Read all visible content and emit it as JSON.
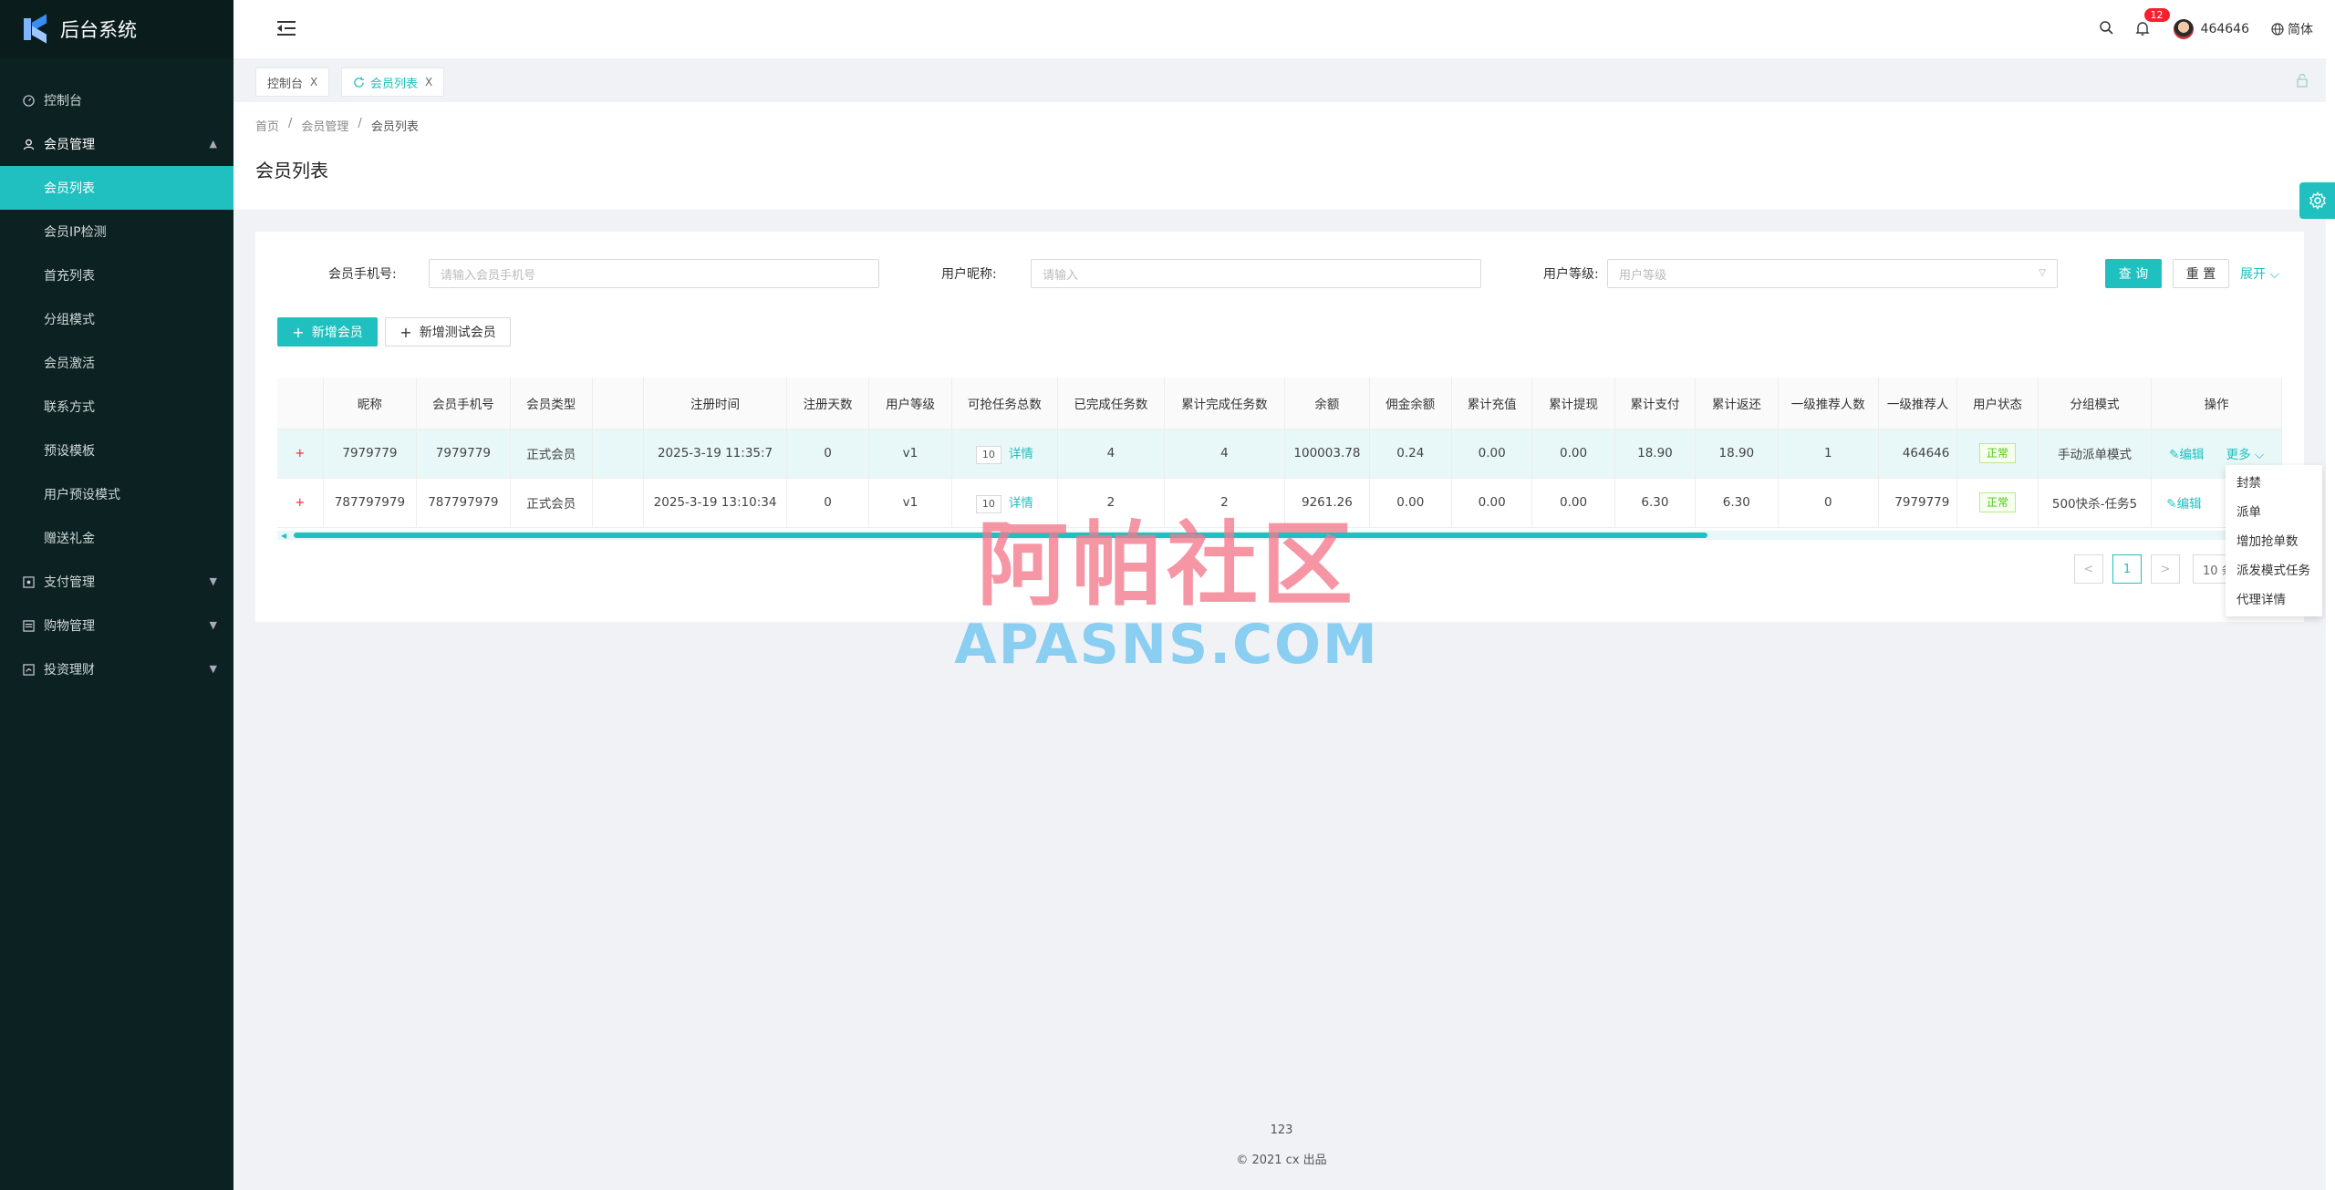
{
  "app": {
    "title": "后台系统"
  },
  "sidebar": {
    "items": [
      {
        "label": "控制台",
        "icon": "dashboard-icon"
      },
      {
        "label": "会员管理",
        "icon": "user-icon",
        "open": true,
        "children": [
          {
            "label": "会员列表",
            "active": true
          },
          {
            "label": "会员IP检测"
          },
          {
            "label": "首充列表"
          },
          {
            "label": "分组模式"
          },
          {
            "label": "会员激活"
          },
          {
            "label": "联系方式"
          },
          {
            "label": "预设模板"
          },
          {
            "label": "用户预设模式"
          },
          {
            "label": "赠送礼金"
          }
        ]
      },
      {
        "label": "支付管理",
        "icon": "pay-icon"
      },
      {
        "label": "购物管理",
        "icon": "shop-icon"
      },
      {
        "label": "投资理财",
        "icon": "invest-icon"
      }
    ]
  },
  "header": {
    "notifications": "12",
    "username": "464646",
    "language": "简体"
  },
  "tabs": [
    {
      "label": "控制台",
      "close": "X"
    },
    {
      "label": "会员列表",
      "close": "X",
      "active": true
    }
  ],
  "breadcrumb": [
    "首页",
    "/",
    "会员管理",
    "/",
    "会员列表"
  ],
  "page_title": "会员列表",
  "filters": {
    "phone_label": "会员手机号:",
    "phone_placeholder": "请输入会员手机号",
    "nick_label": "用户昵称:",
    "nick_placeholder": "请输入",
    "level_label": "用户等级:",
    "level_placeholder": "用户等级",
    "query": "查 询",
    "reset": "重 置",
    "expand": "展开"
  },
  "actions": {
    "add_member": "新增会员",
    "add_test_member": "新增测试会员"
  },
  "table": {
    "columns": [
      "",
      "昵称",
      "会员手机号",
      "会员类型",
      "",
      "注册时间",
      "注册天数",
      "用户等级",
      "可抢任务总数",
      "已完成任务数",
      "累计完成任务数",
      "余额",
      "佣金余额",
      "累计充值",
      "累计提现",
      "累计支付",
      "累计返还",
      "一级推荐人数",
      "一级推荐人",
      "用户状态",
      "分组模式",
      "操作"
    ],
    "rows": [
      {
        "expand": "+",
        "nick": "7979779",
        "phone": "7979779",
        "type": "正式会员",
        "blank": "",
        "reg_time": "2025-3-19 11:35:7",
        "days": "0",
        "level": "v1",
        "tasks": "10",
        "detail": "详情",
        "done": "4",
        "total_done": "4",
        "balance": "100003.78",
        "commission": "0.24",
        "recharge": "0.00",
        "withdraw": "0.00",
        "paid": "18.90",
        "returned": "18.90",
        "ref_count": "1",
        "referrer": "464646",
        "status": "正常",
        "group": "手动派单模式",
        "edit": "编辑",
        "more": "更多"
      },
      {
        "expand": "+",
        "nick": "787797979",
        "phone": "787797979",
        "type": "正式会员",
        "blank": "",
        "reg_time": "2025-3-19 13:10:34",
        "days": "0",
        "level": "v1",
        "tasks": "10",
        "detail": "详情",
        "done": "2",
        "total_done": "2",
        "balance": "9261.26",
        "commission": "0.00",
        "recharge": "0.00",
        "withdraw": "0.00",
        "paid": "6.30",
        "returned": "6.30",
        "ref_count": "0",
        "referrer": "7979779",
        "status": "正常",
        "group": "500快杀-任务5",
        "edit": "编辑"
      }
    ]
  },
  "pagination": {
    "prev": "<",
    "current": "1",
    "next": ">",
    "size": "10 条"
  },
  "dropdown": [
    "封禁",
    "派单",
    "增加抢单数",
    "派发模式任务",
    "代理详情"
  ],
  "watermark": {
    "cn": "阿帕社区",
    "en": "APASNS.COM"
  },
  "footer": {
    "number": "123",
    "copyright": "© 2021 cx 出品"
  },
  "colors": {
    "accent": "#1fc0bf",
    "sidebar": "#0c2121",
    "danger": "#f5222d",
    "success": "#52c41a"
  }
}
